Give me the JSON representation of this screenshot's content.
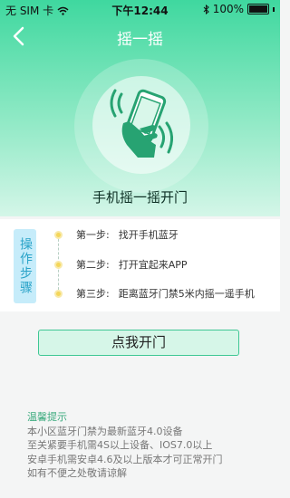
{
  "status_bar": {
    "carrier": "无 SIM 卡",
    "time": "下午12:44",
    "battery": "100%"
  },
  "nav": {
    "title": "摇一摇"
  },
  "hero": {
    "label": "手机摇一摇开门"
  },
  "steps": {
    "tag": "操作步骤",
    "items": [
      {
        "step": "第一步:",
        "text": "找开手机蓝牙"
      },
      {
        "step": "第二步:",
        "text": "打开宜起来APP"
      },
      {
        "step": "第三步:",
        "text": "距离蓝牙门禁5米内摇一遥手机"
      }
    ]
  },
  "open_button": {
    "label": "点我开门"
  },
  "tips": {
    "title": "温馨提示",
    "lines": [
      "本小区蓝牙门禁为最新蓝牙4.0设备",
      "至关紧要手机需4S以上设备、IOS7.0以上",
      "安卓手机需安卓4.6及以上版本才可正常开门",
      "如有不便之处敬请谅解"
    ]
  },
  "colors": {
    "brand_green": "#3fd89f",
    "icon_green": "#27a372",
    "dot_yellow": "#f4d65a",
    "tag_blue": "#c6ecfa"
  },
  "icons": [
    "back-chevron-icon",
    "wifi-icon",
    "bluetooth-icon",
    "battery-icon",
    "shake-phone-icon"
  ]
}
